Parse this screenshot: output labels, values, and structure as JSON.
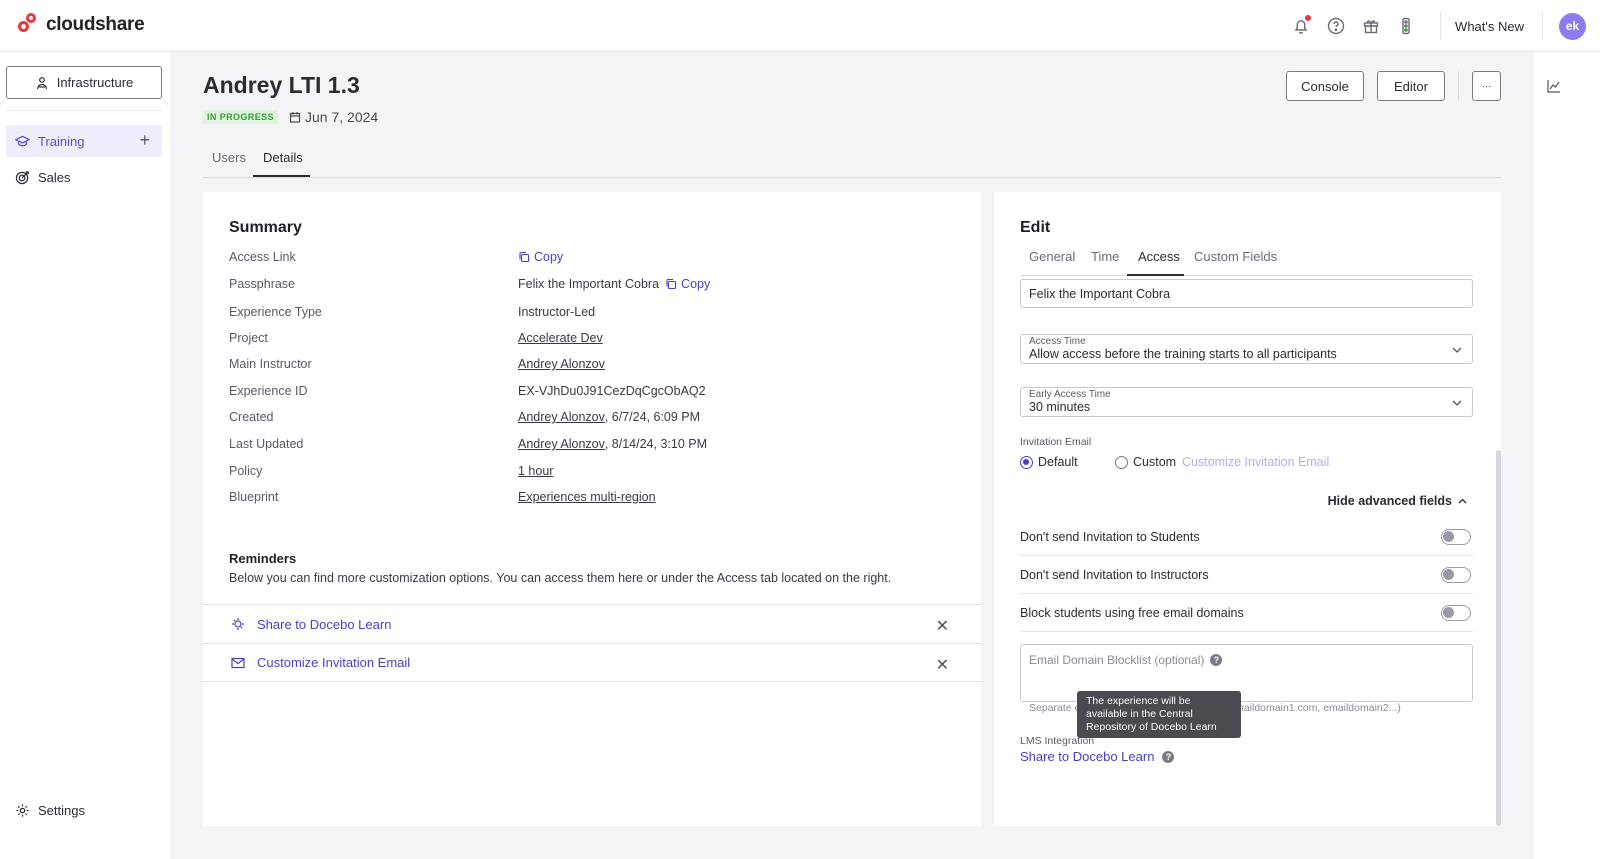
{
  "header": {
    "brand": "cloudshare",
    "whats_new": "What's New",
    "avatar_initials": "ek"
  },
  "sidebar": {
    "infrastructure_label": "Infrastructure",
    "items": [
      {
        "label": "Training",
        "active": true
      },
      {
        "label": "Sales",
        "active": false
      }
    ],
    "settings_label": "Settings"
  },
  "page": {
    "title": "Andrey LTI 1.3",
    "status": "IN PROGRESS",
    "date": "Jun 7, 2024",
    "buttons": {
      "console": "Console",
      "editor": "Editor",
      "more": "···"
    },
    "tabs": [
      {
        "label": "Users",
        "active": false
      },
      {
        "label": "Details",
        "active": true
      }
    ]
  },
  "summary": {
    "title": "Summary",
    "rows": [
      {
        "label": "Access Link",
        "value": "",
        "copy": "Copy"
      },
      {
        "label": "Passphrase",
        "value": "Felix the Important Cobra",
        "copy": "Copy"
      },
      {
        "label": "Experience Type",
        "value": "Instructor-Led"
      },
      {
        "label": "Project",
        "value": "Accelerate Dev"
      },
      {
        "label": "Main Instructor",
        "value": "Andrey Alonzov"
      },
      {
        "label": "Experience ID",
        "value": "EX-VJhDu0J91CezDqCgcObAQ2"
      },
      {
        "label": "Created",
        "value_link": "Andrey Alonzov",
        "value_rest": ", 6/7/24, 6:09 PM"
      },
      {
        "label": "Last Updated",
        "value_link": "Andrey Alonzov",
        "value_rest": ", 8/14/24, 3:10 PM"
      },
      {
        "label": "Policy",
        "value": "1 hour"
      },
      {
        "label": "Blueprint",
        "value": "Experiences multi-region"
      }
    ],
    "reminders_title": "Reminders",
    "reminders_text": "Below you can find more customization options. You can access them here or under the Access tab located on the right.",
    "reminder_items": [
      "Share to Docebo Learn",
      "Customize Invitation Email"
    ]
  },
  "edit": {
    "title": "Edit",
    "tabs": [
      {
        "label": "General",
        "active": false
      },
      {
        "label": "Time",
        "active": false
      },
      {
        "label": "Access",
        "active": true
      },
      {
        "label": "Custom Fields",
        "active": false
      }
    ],
    "passphrase_value": "Felix the Important Cobra",
    "access_time_label": "Access Time",
    "access_time_value": "Allow access before the training starts to all participants",
    "early_access_label": "Early Access Time",
    "early_access_value": "30 minutes",
    "invitation_email_label": "Invitation Email",
    "radio_default": "Default",
    "radio_custom": "Custom",
    "customize_link": "Customize Invitation Email",
    "hide_advanced": "Hide advanced fields",
    "switches": [
      {
        "label": "Don't send Invitation to Students",
        "on": false
      },
      {
        "label": "Don't send Invitation to Instructors",
        "on": false
      },
      {
        "label": "Block students using free email domains",
        "on": false
      }
    ],
    "blocklist_placeholder": "Email Domain Blocklist (optional)",
    "blocklist_helper_start": "Separate e",
    "blocklist_helper_end": "naildomain1.com, emaildomain2...)",
    "tooltip": "The experience will be available in the Central Repository of Docebo Learn",
    "lms_label": "LMS Integration",
    "lms_link": "Share to Docebo Learn"
  }
}
